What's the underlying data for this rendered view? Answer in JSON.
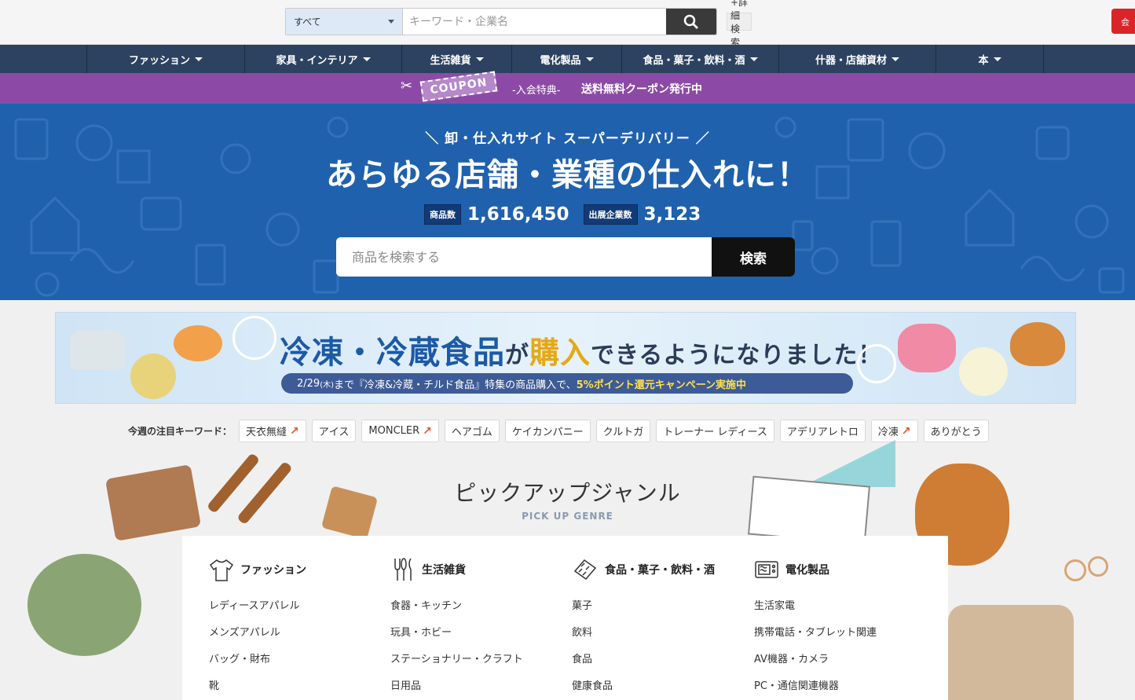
{
  "topbar": {
    "category_select": "すべて",
    "keyword_placeholder": "キーワード・企業名",
    "advanced_search": "+詳細検索"
  },
  "catnav": {
    "items": [
      {
        "label": "ファッション"
      },
      {
        "label": "家具・インテリア"
      },
      {
        "label": "生活雑貨"
      },
      {
        "label": "電化製品"
      },
      {
        "label": "食品・菓子・飲料・酒"
      },
      {
        "label": "什器・店舗資材"
      },
      {
        "label": "本"
      }
    ]
  },
  "coupon": {
    "tag": "COUPON",
    "lead": "-入会特典-",
    "message": "送料無料クーポン発行中"
  },
  "hero": {
    "subtitle": "卸・仕入れサイト スーパーデリバリー",
    "title": "あらゆる店舗・業種の仕入れに！",
    "stats": [
      {
        "label": "商品数",
        "value": "1,616,450"
      },
      {
        "label": "出展企業数",
        "value": "3,123"
      }
    ],
    "search_placeholder": "商品を検索する",
    "search_button": "検索"
  },
  "banner": {
    "title_part1": "冷凍・冷蔵食品",
    "title_part2": "が",
    "title_part3": "購入",
    "title_part4": "できるようになりました！",
    "strip_before": "2/29",
    "strip_day": "(木)",
    "strip_mid": "まで『冷凍&冷蔵・チルド食品』特集の商品購入で、",
    "strip_highlight": "5%ポイント還元キャンペーン実施中"
  },
  "keywords": {
    "label": "今週の注目キーワード：",
    "items": [
      {
        "text": "天衣無縫",
        "trend": true
      },
      {
        "text": "アイス",
        "trend": false
      },
      {
        "text": "MONCLER",
        "trend": true
      },
      {
        "text": "ヘアゴム",
        "trend": false
      },
      {
        "text": "ケイカンパニー",
        "trend": false
      },
      {
        "text": "クルトガ",
        "trend": false
      },
      {
        "text": "トレーナー レディース",
        "trend": false
      },
      {
        "text": "アデリアレトロ",
        "trend": false
      },
      {
        "text": "冷凍",
        "trend": true
      },
      {
        "text": "ありがとう",
        "trend": false
      }
    ]
  },
  "pickup": {
    "title": "ピックアップジャンル",
    "subtitle": "PICK UP GENRE",
    "genres": [
      {
        "title": "ファッション",
        "icon": "shirt-icon",
        "links": [
          "レディースアパレル",
          "メンズアパレル",
          "バッグ・財布",
          "靴"
        ]
      },
      {
        "title": "生活雑貨",
        "icon": "cutlery-icon",
        "links": [
          "食器・キッチン",
          "玩具・ホビー",
          "ステーショナリー・クラフト",
          "日用品"
        ]
      },
      {
        "title": "食品・菓子・飲料・酒",
        "icon": "food-icon",
        "links": [
          "菓子",
          "飲料",
          "食品",
          "健康食品"
        ]
      },
      {
        "title": "電化製品",
        "icon": "appliance-icon",
        "links": [
          "生活家電",
          "携帯電話・タブレット関連",
          "AV機器・カメラ",
          "PC・通信関連機器"
        ]
      }
    ]
  }
}
